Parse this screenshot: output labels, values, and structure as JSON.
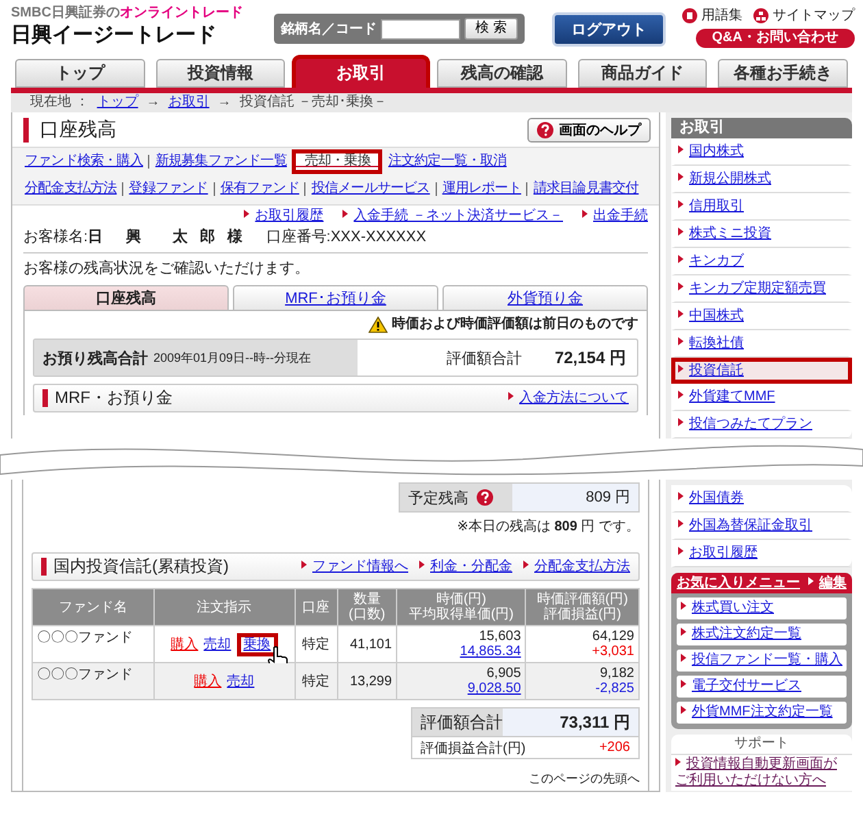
{
  "header": {
    "tagline": "SMBC日興証券の**オンライントレード**",
    "logo": "日興イージートレード",
    "search": {
      "label": "銘柄名／コード",
      "button": "検索"
    },
    "logout": "ログアウト",
    "links": [
      "用語集",
      "サイトマップ"
    ],
    "qa_button": "Q&A・お問い合わせ"
  },
  "nav_tabs": [
    {
      "label": "トップ",
      "selected": false,
      "highlighted": false
    },
    {
      "label": "投資情報",
      "selected": false,
      "highlighted": false
    },
    {
      "label": "お取引",
      "selected": true,
      "highlighted": true
    },
    {
      "label": "残高の確認",
      "selected": false,
      "highlighted": false
    },
    {
      "label": "商品ガイド",
      "selected": false,
      "highlighted": false
    },
    {
      "label": "各種お手続き",
      "selected": false,
      "highlighted": false
    }
  ],
  "breadcrumb": {
    "label": "現在地 ：",
    "separator": "→",
    "items": [
      {
        "text": "トップ",
        "link": true
      },
      {
        "text": "お取引",
        "link": true
      },
      {
        "text": "投資信託 －売却･乗換－",
        "link": false
      }
    ]
  },
  "page": {
    "title": "口座残高",
    "help_button": "画面のヘルプ"
  },
  "subnav_rows": [
    [
      {
        "text": "ファンド検索・購入",
        "selected": false,
        "highlighted": false
      },
      {
        "text": "新規募集ファンド一覧",
        "selected": false,
        "highlighted": false
      },
      {
        "text": "売却・乗換",
        "selected": true,
        "highlighted": true
      },
      {
        "text": "注文約定一覧・取消",
        "selected": false,
        "highlighted": false
      }
    ],
    [
      {
        "text": "分配金支払方法",
        "selected": false,
        "highlighted": false
      },
      {
        "text": "登録ファンド",
        "selected": false,
        "highlighted": false
      },
      {
        "text": "保有ファンド",
        "selected": false,
        "highlighted": false
      },
      {
        "text": "投信メールサービス",
        "selected": false,
        "highlighted": false
      },
      {
        "text": "運用レポート",
        "selected": false,
        "highlighted": false
      },
      {
        "text": "請求目論見書交付",
        "selected": false,
        "highlighted": false
      }
    ]
  ],
  "quick_links": [
    "お取引履歴",
    "入金手続 －ネット決済サービス－",
    "出金手続"
  ],
  "customer": "お客様名:**日　興　 太 郎 様**　 口座番号:XXX-XXXXXX",
  "intro": "お客様の残高状況をご確認いただけます。",
  "balance_tabs": [
    {
      "label": "口座残高",
      "selected": true
    },
    {
      "label": "MRF･お預り金",
      "selected": false
    },
    {
      "label": "外貨預り金",
      "selected": false
    }
  ],
  "notice": "時価および時価評価額は前日のものです",
  "total": {
    "label": "お預り残高合計",
    "timestamp": "2009年01月09日--時--分現在",
    "value_label": "評価額合計",
    "value": "72,154 円"
  },
  "mrf": {
    "title": "MRF・お預り金",
    "link": "入金方法について"
  },
  "scheduled": {
    "label": "予定残高",
    "value": "809 円",
    "note": "※本日の残高は **809** 円 です。"
  },
  "funds": {
    "title": "国内投資信託(累積投資)",
    "links": [
      "ファンド情報へ",
      "利金・分配金",
      "分配金支払方法"
    ],
    "columns": [
      "ファンド名",
      "注文指示",
      "口座",
      "数量\n(口数)",
      "時価(円)\n平均取得単価(円)",
      "時価評価額(円)\n評価損益(円)"
    ],
    "rows": [
      {
        "name": "〇〇〇ファンド",
        "actions": [
          {
            "text": "購入",
            "kind": "buy",
            "highlighted": false
          },
          {
            "text": "売却",
            "kind": "sell",
            "highlighted": false
          },
          {
            "text": "乗換",
            "kind": "switch",
            "highlighted": true
          }
        ],
        "account": "特定",
        "quantity": "41,101",
        "price": "15,603",
        "avg_cost": "14,865.34",
        "value": "64,129",
        "pl": "+3,031",
        "loss": false
      },
      {
        "name": "〇〇〇ファンド",
        "actions": [
          {
            "text": "購入",
            "kind": "buy",
            "highlighted": false
          },
          {
            "text": "売却",
            "kind": "sell",
            "highlighted": false
          }
        ],
        "account": "特定",
        "quantity": "13,299",
        "price": "6,905",
        "avg_cost": "9,028.50",
        "value": "9,182",
        "pl": "-2,825",
        "loss": true
      }
    ],
    "totals": {
      "value_label": "評価額合計",
      "value": "73,311 円",
      "pl_label": "評価損益合計(円)",
      "pl": "+206"
    }
  },
  "page_top_link": "このページの先頭へ",
  "sidebar": {
    "title": "お取引",
    "items_upper": [
      {
        "text": "国内株式",
        "selected": false,
        "highlighted": false
      },
      {
        "text": "新規公開株式",
        "selected": false,
        "highlighted": false
      },
      {
        "text": "信用取引",
        "selected": false,
        "highlighted": false
      },
      {
        "text": "株式ミニ投資",
        "selected": false,
        "highlighted": false
      },
      {
        "text": "キンカブ",
        "selected": false,
        "highlighted": false
      },
      {
        "text": "キンカブ定期定額売買",
        "selected": false,
        "highlighted": false
      },
      {
        "text": "中国株式",
        "selected": false,
        "highlighted": false
      },
      {
        "text": "転換社債",
        "selected": false,
        "highlighted": false
      },
      {
        "text": "投資信託",
        "selected": true,
        "highlighted": true
      },
      {
        "text": "外貨建てMMF",
        "selected": false,
        "highlighted": false
      },
      {
        "text": "投信つみたてプラン",
        "selected": false,
        "highlighted": false
      }
    ],
    "items_lower": [
      {
        "text": "外国債券",
        "selected": false,
        "highlighted": false
      },
      {
        "text": "外国為替保証金取引",
        "selected": false,
        "highlighted": false
      },
      {
        "text": "お取引履歴",
        "selected": false,
        "highlighted": false
      }
    ]
  },
  "favorites": {
    "title": "お気に入りメニュー",
    "edit": "編集",
    "items": [
      "株式買い注文",
      "株式注文約定一覧",
      "投信ファンド一覧・購入",
      "電子交付サービス",
      "外貨MMF注文約定一覧"
    ]
  },
  "support": {
    "title": "サポート",
    "link": "投資情報自動更新画面がご利用いただけない方へ"
  }
}
